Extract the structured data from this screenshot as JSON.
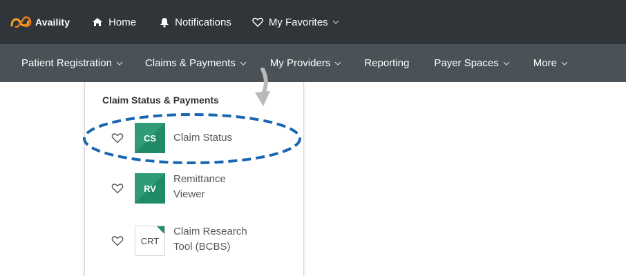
{
  "brand": {
    "name": "Availity",
    "trademark": "·"
  },
  "topbar": {
    "items": [
      {
        "label": "Home",
        "icon": "home-icon"
      },
      {
        "label": "Notifications",
        "icon": "bell-icon"
      },
      {
        "label": "My Favorites",
        "icon": "heart-outline-icon"
      }
    ]
  },
  "navbar": {
    "items": [
      {
        "label": "Patient Registration"
      },
      {
        "label": "Claims & Payments"
      },
      {
        "label": "My Providers"
      },
      {
        "label": "Reporting"
      },
      {
        "label": "Payer Spaces"
      },
      {
        "label": "More"
      }
    ]
  },
  "dropdown": {
    "heading": "Claim Status & Payments",
    "items": [
      {
        "badge": "CS",
        "label_line1": "Claim Status",
        "label_line2": ""
      },
      {
        "badge": "RV",
        "label_line1": "Remittance",
        "label_line2": "Viewer"
      },
      {
        "badge": "CRT",
        "label_line1": "Claim Research",
        "label_line2": "Tool (BCBS)"
      }
    ]
  },
  "colors": {
    "topbar_bg": "#2f3539",
    "navbar_bg": "#4a5257",
    "badge_green": "#2f9c77",
    "highlight_blue": "#1a66b0",
    "logo_orange": "#f39c12"
  }
}
